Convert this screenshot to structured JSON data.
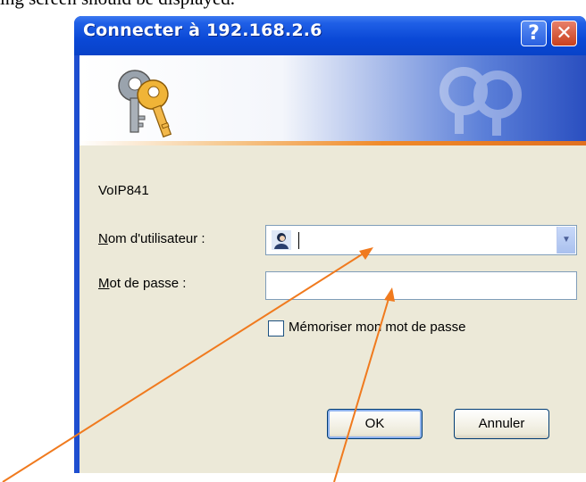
{
  "page": {
    "top_text": "ing screen should be displayed."
  },
  "window": {
    "title": "Connecter à 192.168.2.6",
    "help_button": "?",
    "close_button": "✕"
  },
  "dialog": {
    "realm": "VoIP841",
    "username_label_mnemonic": "N",
    "username_label_rest": "om d'utilisateur :",
    "password_label_mnemonic": "M",
    "password_label_rest": "ot de passe :",
    "username_value": "",
    "password_value": "",
    "remember_label": "Mémoriser mon mot de passe",
    "remember_checked": false,
    "ok_label": "OK",
    "cancel_label": "Annuler"
  },
  "colors": {
    "titlebar": "#0a48d6",
    "arrow": "#f07a1e",
    "dialog_bg": "#ece9d8"
  },
  "icons": {
    "banner": "keys-icon",
    "user": "user-icon",
    "dropdown": "chevron-down-icon"
  }
}
